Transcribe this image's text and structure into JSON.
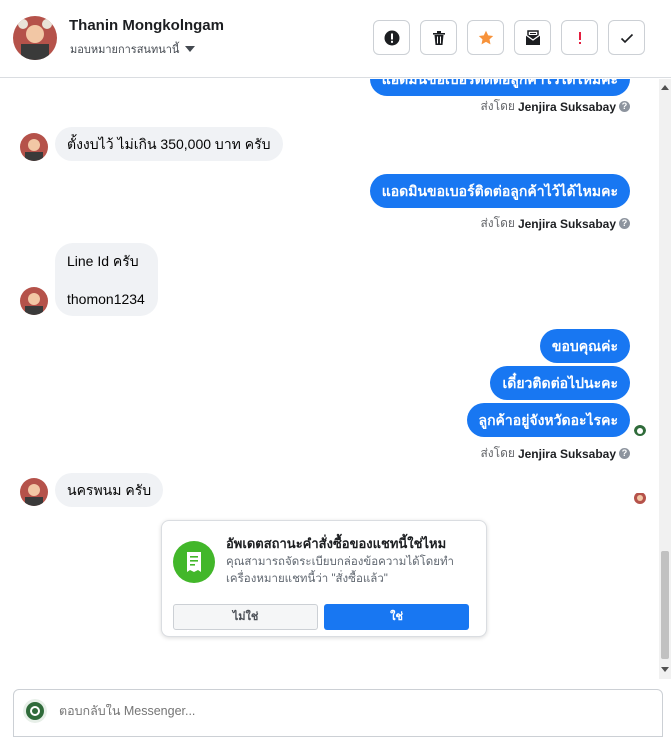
{
  "header": {
    "name": "Thanin Mongkolngam",
    "assign_label": "มอบหมายการสนทนานี้"
  },
  "toolbar": {
    "buttons": [
      "info-icon",
      "trash-icon",
      "star-icon",
      "mail-icon",
      "exclamation-icon",
      "check-icon"
    ]
  },
  "messages": [
    {
      "dir": "out",
      "text": "แอดมินขอเบอร์ติดต่อลูกค้าไว้ได้ไหมคะ",
      "partial": true
    },
    {
      "dir": "meta",
      "prefix": "ส่งโดย",
      "sender": "Jenjira Suksabay"
    },
    {
      "dir": "in",
      "text": "ตั้งงบไว้ ไม่เกิน 350,000 บาท ครับ"
    },
    {
      "dir": "out",
      "text": "แอดมินขอเบอร์ติดต่อลูกค้าไว้ได้ไหมคะ"
    },
    {
      "dir": "meta",
      "prefix": "ส่งโดย",
      "sender": "Jenjira Suksabay"
    },
    {
      "dir": "in",
      "line1": "Line Id ครับ",
      "line2": "thomon1234"
    },
    {
      "dir": "out",
      "text": "ขอบคุณค่ะ"
    },
    {
      "dir": "out",
      "text": "เดี๋ยวติดต่อไปนะคะ"
    },
    {
      "dir": "out",
      "text": "ลูกค้าอยู่จังหวัดอะไรคะ"
    },
    {
      "dir": "meta",
      "prefix": "ส่งโดย",
      "sender": "Jenjira Suksabay"
    },
    {
      "dir": "in",
      "text": "นครพนม ครับ"
    }
  ],
  "prompt_card": {
    "title": "อัพเดตสถานะคำสั่งซื้อของแชทนี้ใช่ไหม",
    "description": "คุณสามารถจัดระเบียบกล่องข้อความได้โดยทำเครื่องหมายแชทนี้ว่า \"สั่งซื้อแล้ว\"",
    "no_label": "ไม่ใช่",
    "yes_label": "ใช่"
  },
  "composer": {
    "placeholder": "ตอบกลับใน Messenger..."
  },
  "colors": {
    "brand_blue": "#1877f2",
    "card_green": "#42b72a",
    "incoming_bg": "#f0f2f5",
    "star_orange": "#f7923a",
    "alert_red": "#e41e3f"
  }
}
